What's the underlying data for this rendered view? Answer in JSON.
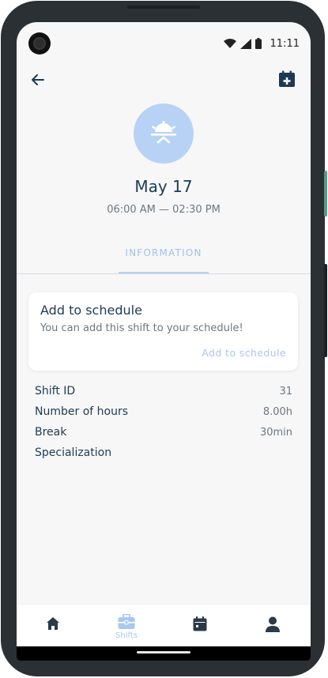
{
  "status_bar": {
    "time": "11:11"
  },
  "header": {
    "title": "May 17",
    "subtitle": "06:00 AM — 02:30 PM"
  },
  "tabs": [
    {
      "label": "INFORMATION",
      "active": true
    }
  ],
  "card": {
    "title": "Add to schedule",
    "text": "You can add this shift to your schedule!",
    "action": "Add to schedule"
  },
  "info": [
    {
      "label": "Shift ID",
      "value": "31"
    },
    {
      "label": "Number of hours",
      "value": "8.00h"
    },
    {
      "label": "Break",
      "value": "30min"
    },
    {
      "label": "Specialization",
      "value": ""
    }
  ],
  "bottom_nav": [
    {
      "icon": "home-icon",
      "label": ""
    },
    {
      "icon": "briefcase-icon",
      "label": "Shifts",
      "active": true
    },
    {
      "icon": "calendar-icon",
      "label": ""
    },
    {
      "icon": "profile-icon",
      "label": ""
    }
  ],
  "colors": {
    "accent_light": "#b8d2f5",
    "accent_text": "#a9c8ee",
    "primary_text": "#1e3a52",
    "secondary_text": "#6c7781"
  }
}
